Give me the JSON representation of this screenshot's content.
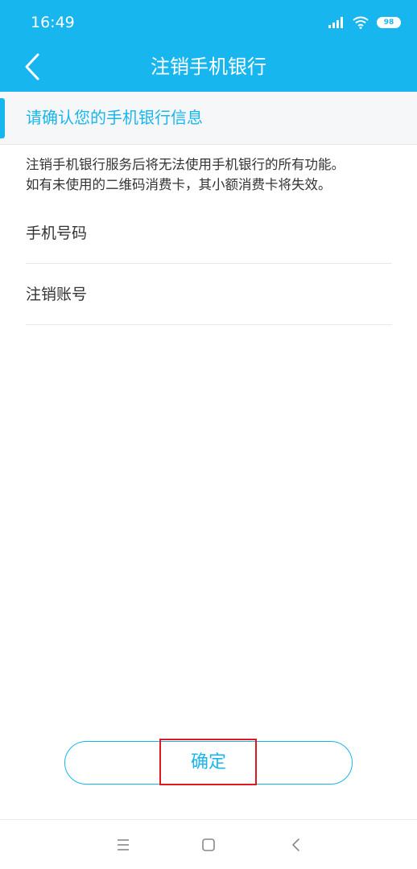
{
  "status_bar": {
    "time": "16:49",
    "battery": "98",
    "icons": [
      "signal-icon",
      "wifi-icon",
      "battery-icon"
    ]
  },
  "nav": {
    "back_icon": "chevron-left-icon",
    "title": "注销手机银行"
  },
  "section": {
    "title": "请确认您的手机银行信息"
  },
  "notice": {
    "line1": "注销手机银行服务后将无法使用手机银行的所有功能。",
    "line2": "如有未使用的二维码消费卡，其小额消费卡将失效。"
  },
  "rows": [
    {
      "label": "手机号码"
    },
    {
      "label": "注销账号"
    }
  ],
  "confirm": {
    "label": "确定"
  },
  "system_nav": {
    "icons": [
      "menu-icon",
      "home-icon",
      "back-icon"
    ]
  },
  "colors": {
    "accent": "#18b6ee",
    "highlight": "#e0181f",
    "text": "#333333"
  }
}
